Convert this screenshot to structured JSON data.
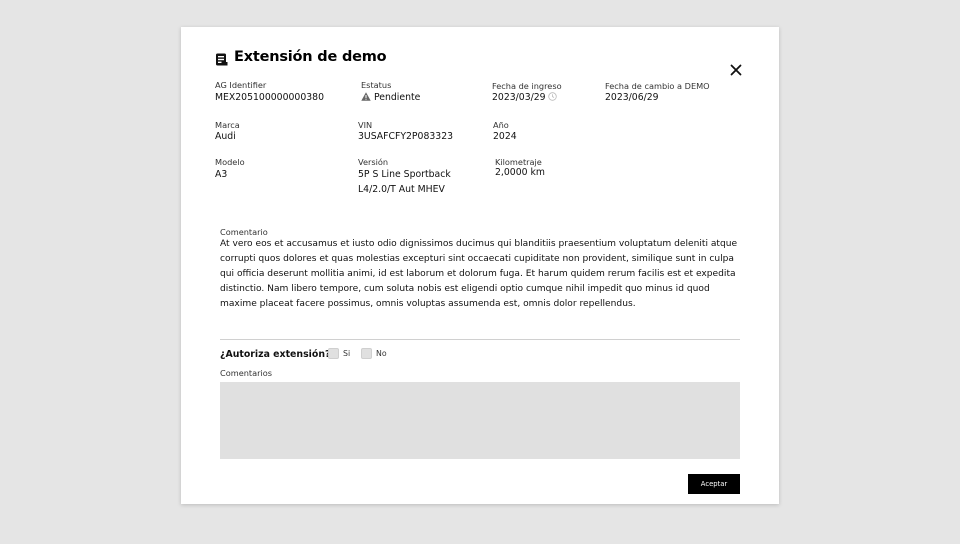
{
  "dialog": {
    "title": "Extensión de demo",
    "title_icon": "document-icon",
    "close_icon": "close-icon"
  },
  "fields": {
    "ag_identifier": {
      "label": "AG Identifier",
      "value": "MEX205100000000380"
    },
    "estatus": {
      "label": "Estatus",
      "value": "Pendiente",
      "icon": "warning-icon"
    },
    "fecha_ingreso": {
      "label": "Fecha de ingreso",
      "value": "2023/03/29",
      "icon": "clock-icon"
    },
    "fecha_cambio": {
      "label": "Fecha de cambio a DEMO",
      "value": "2023/06/29"
    },
    "marca": {
      "label": "Marca",
      "value": "Audi"
    },
    "vin": {
      "label": "VIN",
      "value": "3USAFCFY2P083323"
    },
    "anio": {
      "label": "Año",
      "value": "2024"
    },
    "modelo": {
      "label": "Modelo",
      "value": "A3"
    },
    "version": {
      "label": "Versión",
      "value_line1": "5P S Line Sportback",
      "value_line2": "L4/2.0/T Aut MHEV"
    },
    "kilometraje": {
      "label": "Kilometraje",
      "value": "2,0000 km"
    }
  },
  "comment": {
    "label": "Comentario",
    "text": "At vero eos et accusamus et iusto odio dignissimos ducimus qui blanditiis praesentium voluptatum deleniti atque corrupti quos dolores et quas molestias excepturi sint occaecati cupiditate non provident, similique sunt in culpa qui officia deserunt mollitia animi, id est laborum et dolorum fuga. Et harum quidem rerum facilis est et expedita distinctio. Nam libero tempore, cum soluta nobis est eligendi optio cumque nihil impedit quo minus id quod maxime placeat facere possimus, omnis voluptas assumenda est, omnis dolor repellendus."
  },
  "authorize": {
    "question": "¿Autoriza extensión?",
    "option_yes": "Si",
    "option_no": "No"
  },
  "comentarios": {
    "label": "Comentarios",
    "value": ""
  },
  "actions": {
    "accept_label": "Aceptar"
  },
  "colors": {
    "background": "#e5e5e5",
    "modal": "#ffffff",
    "primary_button": "#000000",
    "input_fill": "#e0e0e0",
    "warning_icon": "#666666"
  }
}
